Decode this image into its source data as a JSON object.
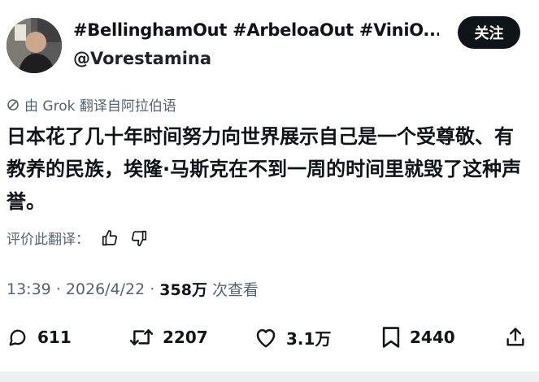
{
  "author": {
    "display_name": "#BellinghamOut #ArbeloaOut #ViniO...",
    "handle": "@Vorestamina"
  },
  "follow_label": "关注",
  "translation_note": "由 Grok 翻译自阿拉伯语",
  "tweet": {
    "text": "日本花了几十年时间努力向世界展示自己是一个受尊敬、有教养的民族，埃隆·马斯克在不到一周的时间里就毁了这种声誉。"
  },
  "rate_translation_label": "评价此翻译：",
  "meta": {
    "time": "13:39",
    "separator1": "·",
    "date": "2026/4/22",
    "separator2": "·",
    "views": "358万",
    "views_suffix": "次查看"
  },
  "actions": {
    "replies": "611",
    "reposts": "2207",
    "likes": "3.1万",
    "bookmarks": "2440"
  },
  "colors": {
    "text": "#0f1419",
    "secondary": "#536471",
    "button_bg": "#0f1419"
  }
}
